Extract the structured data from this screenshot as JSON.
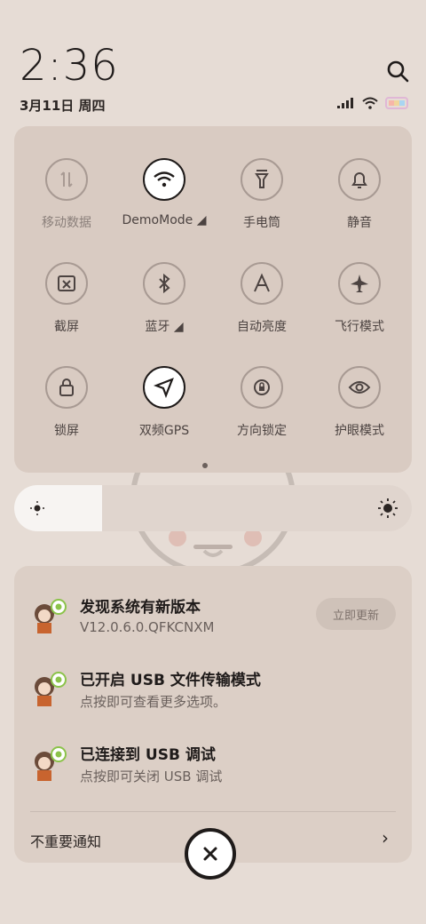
{
  "clock": {
    "time": "2:36",
    "date": "3月11日 周四"
  },
  "tiles": [
    {
      "label": "移动数据",
      "icon": "mobile-data-icon",
      "active": false
    },
    {
      "label": "DemoMode ◢",
      "icon": "wifi-icon",
      "active": true
    },
    {
      "label": "手电筒",
      "icon": "flashlight-icon",
      "active": false
    },
    {
      "label": "静音",
      "icon": "bell-icon",
      "active": false
    },
    {
      "label": "截屏",
      "icon": "screenshot-icon",
      "active": false
    },
    {
      "label": "蓝牙 ◢",
      "icon": "bluetooth-icon",
      "active": false
    },
    {
      "label": "自动亮度",
      "icon": "auto-brightness-icon",
      "active": false
    },
    {
      "label": "飞行模式",
      "icon": "airplane-icon",
      "active": false
    },
    {
      "label": "锁屏",
      "icon": "lock-icon",
      "active": false
    },
    {
      "label": "双频GPS",
      "icon": "gps-icon",
      "active": true
    },
    {
      "label": "方向锁定",
      "icon": "rotation-lock-icon",
      "active": false
    },
    {
      "label": "护眼模式",
      "icon": "eye-icon",
      "active": false
    }
  ],
  "notifications": [
    {
      "title": "发现系统有新版本",
      "subtitle": "V12.0.6.0.QFKCNXM",
      "action": "立即更新"
    },
    {
      "title": "已开启 USB 文件传输模式",
      "subtitle": "点按即可查看更多选项。"
    },
    {
      "title": "已连接到 USB 调试",
      "subtitle": "点按即可关闭 USB 调试"
    }
  ],
  "footer": {
    "unimportant_label": "不重要通知"
  },
  "brightness_level": 0.22,
  "colors": {
    "panel": "#d9cbc2",
    "background": "#e6dcd5"
  }
}
